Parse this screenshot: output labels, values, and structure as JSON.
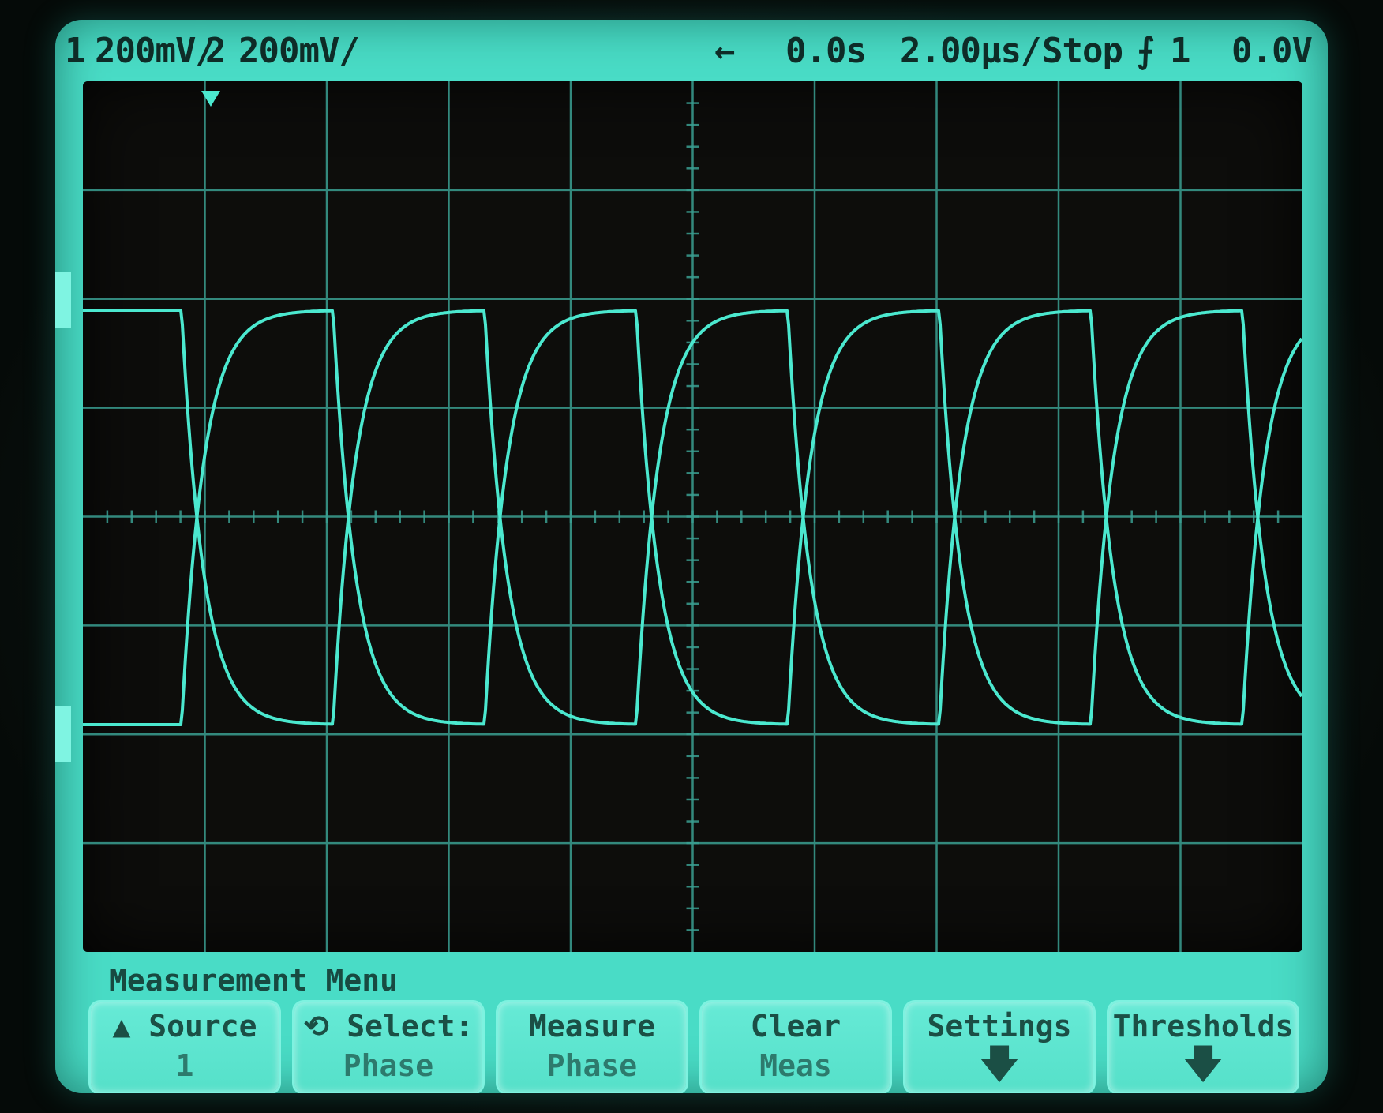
{
  "status_bar": {
    "ch1_num": "1",
    "ch1_scale": "200mV/",
    "ch2_num": "2",
    "ch2_scale": "200mV/",
    "delay_arrow": "←",
    "delay": "0.0s",
    "timebase": "2.00µs/",
    "run_state": "Stop",
    "trigger_icon": "rising-edge-icon",
    "trigger_symbol": "⨍",
    "trigger_source": "1",
    "trigger_level": "0.0V"
  },
  "menu": {
    "title": "Measurement Menu",
    "softkeys": [
      {
        "line1": "▲ Source",
        "line2": "1"
      },
      {
        "line1": "⟲ Select:",
        "line2": "Phase"
      },
      {
        "line1": "Measure",
        "line2": "Phase"
      },
      {
        "line1": "Clear",
        "line2": "Meas"
      },
      {
        "line1": "Settings",
        "arrow": "🡇"
      },
      {
        "line1": "Thresholds",
        "arrow": "🡇"
      }
    ]
  },
  "colors": {
    "screen": "#49dcc6",
    "grid": "#3a9f92",
    "trace": "#4be8cf",
    "text": "#0e2c27"
  }
}
